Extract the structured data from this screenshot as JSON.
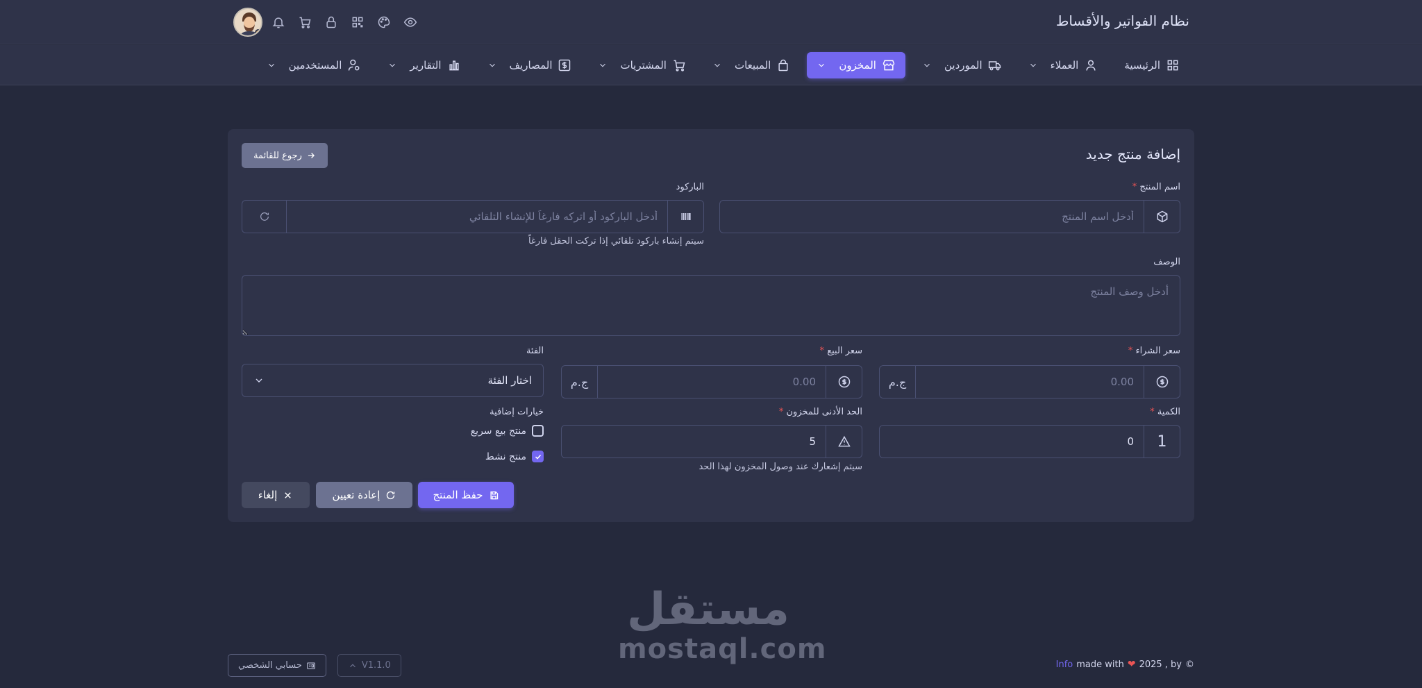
{
  "header": {
    "app_title": "نظام الفواتير والأقساط",
    "icons": [
      "eye-icon",
      "palette-icon",
      "grid-icon",
      "lock-icon",
      "cart-icon",
      "bell-icon"
    ]
  },
  "nav": {
    "items": [
      {
        "label": "الرئيسية",
        "icon": "dashboard-icon",
        "dropdown": false
      },
      {
        "label": "العملاء",
        "icon": "user-icon",
        "dropdown": true
      },
      {
        "label": "الموردين",
        "icon": "truck-icon",
        "dropdown": true
      },
      {
        "label": "المخزون",
        "icon": "store-icon",
        "dropdown": true,
        "active": true
      },
      {
        "label": "المبيعات",
        "icon": "bag-icon",
        "dropdown": true
      },
      {
        "label": "المشتريات",
        "icon": "cart-icon",
        "dropdown": true
      },
      {
        "label": "المصاريف",
        "icon": "dollar-icon",
        "dropdown": true
      },
      {
        "label": "التقارير",
        "icon": "chart-icon",
        "dropdown": true
      },
      {
        "label": "المستخدمين",
        "icon": "user-cog-icon",
        "dropdown": true
      }
    ]
  },
  "form": {
    "title": "إضافة منتج جديد",
    "back_label": "رجوع للقائمة",
    "product_name": {
      "label": "اسم المنتج",
      "required": "*",
      "placeholder": "أدخل اسم المنتج"
    },
    "barcode": {
      "label": "الباركود",
      "placeholder": "أدخل الباركود أو اتركه فارغاً للإنشاء التلقائي",
      "hint": "سيتم إنشاء باركود تلقائي إذا تركت الحقل فارغاً"
    },
    "description": {
      "label": "الوصف",
      "placeholder": "أدخل وصف المنتج"
    },
    "purchase_price": {
      "label": "سعر الشراء",
      "required": "*",
      "placeholder": "0.00",
      "currency": "ج.م"
    },
    "sale_price": {
      "label": "سعر البيع",
      "required": "*",
      "placeholder": "0.00",
      "currency": "ج.م"
    },
    "category": {
      "label": "الفئة",
      "selected": "اختار الفئة"
    },
    "quantity": {
      "label": "الكمية",
      "required": "*",
      "value": "0",
      "addon": "1"
    },
    "min_stock": {
      "label": "الحد الأدنى للمخزون",
      "required": "*",
      "value": "5",
      "hint": "سيتم إشعارك عند وصول المخزون لهذا الحد"
    },
    "extra_options": {
      "label": "خيارات إضافية",
      "quick_sale": {
        "label": "منتج بيع سريع",
        "checked": false
      },
      "active": {
        "label": "منتج نشط",
        "checked": true
      }
    },
    "save_label": "حفظ المنتج",
    "reset_label": "إعادة تعيين",
    "cancel_label": "إلغاء"
  },
  "watermark": {
    "arabic": "مستقل",
    "latin": "mostaql.com"
  },
  "footer": {
    "profile_label": "حسابي الشخصي",
    "version_label": "V1.1.0",
    "copyright_prefix": "©",
    "copyright_text": "2025 , by",
    "made_with": "made with",
    "link_text": "Info"
  },
  "colors": {
    "accent": "#7367f0",
    "background": "#25293c",
    "surface": "#2f3349",
    "danger": "#ea5455"
  }
}
